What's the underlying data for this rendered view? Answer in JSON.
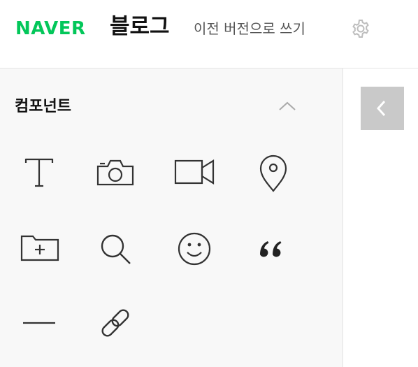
{
  "header": {
    "brand": "NAVER",
    "service": "블로그",
    "prev_version_link": "이전 버전으로 쓰기",
    "settings_icon": "gear-icon",
    "brand_color": "#03c75a"
  },
  "panel": {
    "title": "컴포넌트",
    "collapse_icon": "chevron-up-icon",
    "components": [
      {
        "icon": "text-icon"
      },
      {
        "icon": "camera-icon"
      },
      {
        "icon": "video-icon"
      },
      {
        "icon": "location-pin-icon"
      },
      {
        "icon": "folder-add-icon"
      },
      {
        "icon": "search-icon"
      },
      {
        "icon": "smiley-icon"
      },
      {
        "icon": "quote-icon"
      },
      {
        "icon": "divider-line-icon"
      },
      {
        "icon": "link-icon"
      }
    ]
  },
  "sidebar_toggle": {
    "icon": "chevron-left-icon"
  }
}
